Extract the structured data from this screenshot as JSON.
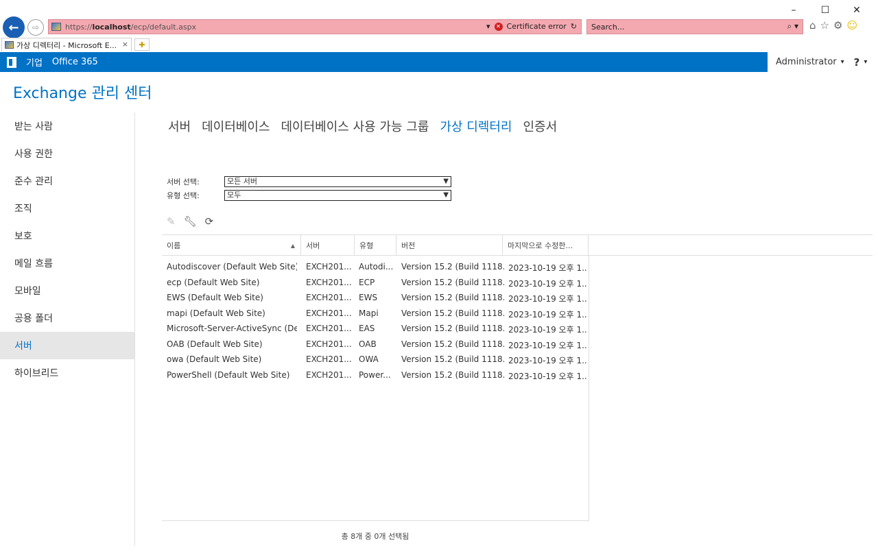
{
  "browser": {
    "url_prefix": "https://",
    "url_host": "localhost",
    "url_path": "/ecp/default.aspx",
    "dropdown_glyph": "▾",
    "cert_error": "Certificate error",
    "refresh_glyph": "↻",
    "search_placeholder": "Search...",
    "search_glyph": "⌕ ▾",
    "tab_title": "가상 디렉터리 - Microsoft E...",
    "tab_close": "×",
    "icons": [
      "home-icon",
      "favorites-icon",
      "settings-icon",
      "smiley-icon"
    ]
  },
  "o365": {
    "nav_enterprise": "기업",
    "nav_office": "Office 365",
    "admin_label": "Administrator",
    "admin_caret": "▾",
    "help_label": "?",
    "help_caret": "▾"
  },
  "app_title": "Exchange 관리 센터",
  "left_nav": [
    {
      "label": "받는 사람",
      "active": false
    },
    {
      "label": "사용 권한",
      "active": false
    },
    {
      "label": "준수 관리",
      "active": false
    },
    {
      "label": "조직",
      "active": false
    },
    {
      "label": "보호",
      "active": false
    },
    {
      "label": "메일 흐름",
      "active": false
    },
    {
      "label": "모바일",
      "active": false
    },
    {
      "label": "공용 폴더",
      "active": false
    },
    {
      "label": "서버",
      "active": true
    },
    {
      "label": "하이브리드",
      "active": false
    }
  ],
  "top_tabs": [
    {
      "label": "서버",
      "active": false
    },
    {
      "label": "데이터베이스",
      "active": false
    },
    {
      "label": "데이터베이스 사용 가능 그룹",
      "active": false
    },
    {
      "label": "가상 디렉터리",
      "active": true
    },
    {
      "label": "인증서",
      "active": false
    }
  ],
  "filters": {
    "server_label": "서버 선택:",
    "server_value": "모든 서버",
    "type_label": "유형 선택:",
    "type_value": "모두"
  },
  "columns": [
    "이름",
    "서버",
    "유형",
    "버전",
    "마지막으로 수정한..."
  ],
  "sort_glyph": "▲",
  "rows": [
    [
      "Autodiscover (Default Web Site)",
      "EXCH201...",
      "Autodi...",
      "Version 15.2 (Build 1118...",
      "2023-10-19 오후 1..."
    ],
    [
      "ecp (Default Web Site)",
      "EXCH201...",
      "ECP",
      "Version 15.2 (Build 1118...",
      "2023-10-19 오후 1..."
    ],
    [
      "EWS (Default Web Site)",
      "EXCH201...",
      "EWS",
      "Version 15.2 (Build 1118...",
      "2023-10-19 오후 1..."
    ],
    [
      "mapi (Default Web Site)",
      "EXCH201...",
      "Mapi",
      "Version 15.2 (Build 1118...",
      "2023-10-19 오후 1..."
    ],
    [
      "Microsoft-Server-ActiveSync (Def...",
      "EXCH201...",
      "EAS",
      "Version 15.2 (Build 1118...",
      "2023-10-19 오후 1..."
    ],
    [
      "OAB (Default Web Site)",
      "EXCH201...",
      "OAB",
      "Version 15.2 (Build 1118...",
      "2023-10-19 오후 1..."
    ],
    [
      "owa (Default Web Site)",
      "EXCH201...",
      "OWA",
      "Version 15.2 (Build 1118...",
      "2023-10-19 오후 1..."
    ],
    [
      "PowerShell (Default Web Site)",
      "EXCH201...",
      "Power...",
      "Version 15.2 (Build 1118...",
      "2023-10-19 오후 1..."
    ]
  ],
  "status": "총 8개 중 0개 선택됨",
  "colors": {
    "accent": "#0072c6",
    "addr_error": "#f4a8b0",
    "nav_active_bg": "#e6e6e6"
  }
}
